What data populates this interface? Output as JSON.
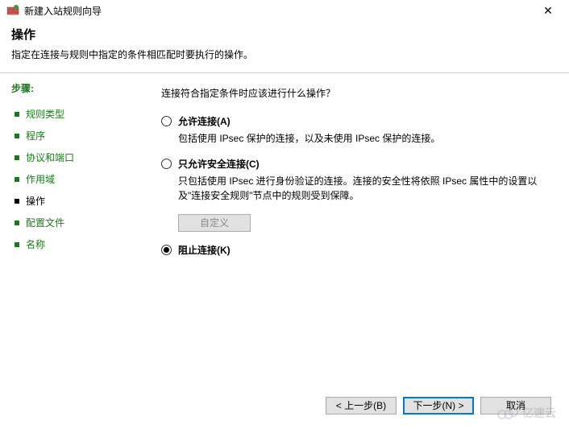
{
  "window": {
    "title": "新建入站规则向导",
    "close": "✕"
  },
  "header": {
    "title": "操作",
    "desc": "指定在连接与规则中指定的条件相匹配时要执行的操作。"
  },
  "sidebar": {
    "steps_label": "步骤:",
    "items": [
      {
        "label": "规则类型"
      },
      {
        "label": "程序"
      },
      {
        "label": "协议和端口"
      },
      {
        "label": "作用域"
      },
      {
        "label": "操作"
      },
      {
        "label": "配置文件"
      },
      {
        "label": "名称"
      }
    ],
    "current_index": 4
  },
  "main": {
    "prompt": "连接符合指定条件时应该进行什么操作？",
    "options": [
      {
        "label": "允许连接(A)",
        "desc": "包括使用 IPsec 保护的连接，以及未使用 IPsec 保护的连接。"
      },
      {
        "label": "只允许安全连接(C)",
        "desc": "只包括使用 IPsec 进行身份验证的连接。连接的安全性将依照 IPsec 属性中的设置以及\"连接安全规则\"节点中的规则受到保障。"
      },
      {
        "label": "阻止连接(K)",
        "desc": ""
      }
    ],
    "selected_index": 2,
    "customize_label": "自定义"
  },
  "footer": {
    "back": "< 上一步(B)",
    "next": "下一步(N) >",
    "cancel": "取消"
  },
  "watermark": {
    "text": "亿速云"
  }
}
